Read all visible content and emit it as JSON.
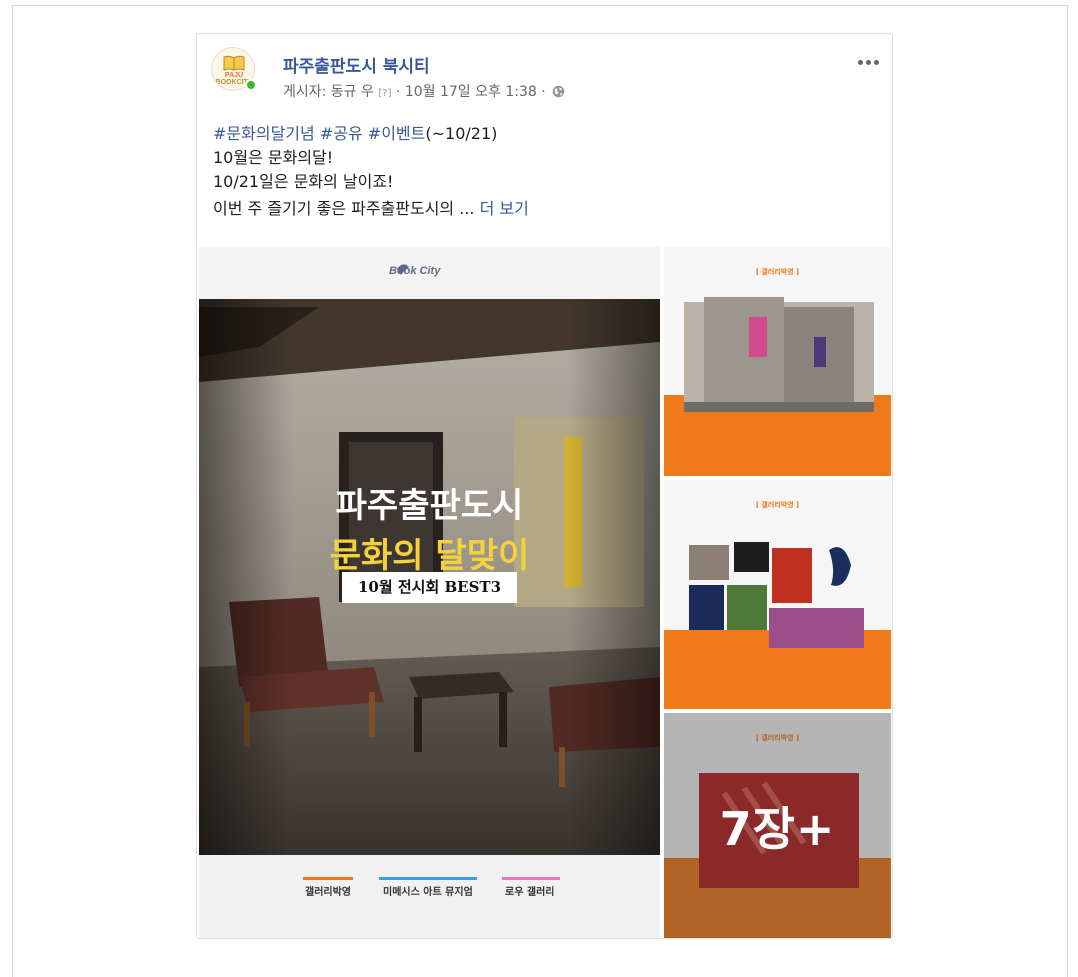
{
  "post": {
    "page_name": "파주출판도시 북시티",
    "avatar_text_top": "PAJU",
    "avatar_text_bottom": "BOOKCITY",
    "author_prefix": "게시자: 동규 우 ",
    "help_marker": "[?]",
    "separator": " · ",
    "timestamp": "10월 17일 오후 1:38",
    "text": {
      "line1_tags": [
        "#문화의달기념",
        "#공유",
        "#이벤트"
      ],
      "line1_tail": "(~10/21)",
      "line2": "10월은 문화의달!",
      "line3": "10/21일은 문화의 날이죠!",
      "line4": "이번 주 즐기기 좋은 파주출판도시의 ... ",
      "see_more": "더 보기"
    }
  },
  "photos": {
    "main": {
      "logo": "Book City",
      "title_line1": "파주출판도시",
      "title_line2": "문화의 달맞이",
      "subtitle": "10월 전시회 BEST3",
      "galleries": [
        "갤러리박영",
        "미메시스 아트 뮤지엄",
        "로우 갤러리"
      ]
    },
    "side1_title": "[ 갤러리박영 ]",
    "side2_title": "[ 갤러리박영 ]",
    "side3_title": "[ 갤러리박영 ]",
    "more_count": "7장+"
  },
  "colors": {
    "link": "#385898",
    "orange": "#f07a1a",
    "yellow_title": "#f3d23c",
    "online": "#42b72a"
  },
  "icons": [
    "book-icon",
    "globe-icon",
    "more-options-icon"
  ]
}
